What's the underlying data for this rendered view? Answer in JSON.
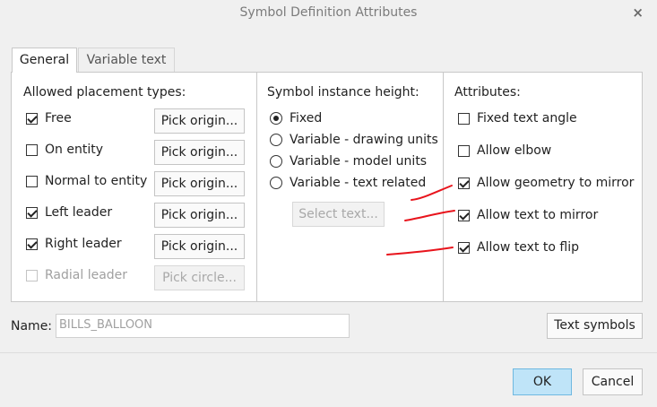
{
  "window": {
    "title": "Symbol Definition Attributes",
    "close_glyph": "×"
  },
  "tabs": [
    {
      "label": "General",
      "active": true
    },
    {
      "label": "Variable text",
      "active": false
    }
  ],
  "placement": {
    "title": "Allowed placement types:",
    "items": [
      {
        "label": "Free",
        "checked": true,
        "enabled": true,
        "button": "Pick origin...",
        "button_enabled": true
      },
      {
        "label": "On entity",
        "checked": false,
        "enabled": true,
        "button": "Pick origin...",
        "button_enabled": true
      },
      {
        "label": "Normal to entity",
        "checked": false,
        "enabled": true,
        "button": "Pick origin...",
        "button_enabled": true
      },
      {
        "label": "Left leader",
        "checked": true,
        "enabled": true,
        "button": "Pick origin...",
        "button_enabled": true
      },
      {
        "label": "Right leader",
        "checked": true,
        "enabled": true,
        "button": "Pick origin...",
        "button_enabled": true
      },
      {
        "label": "Radial leader",
        "checked": false,
        "enabled": false,
        "button": "Pick circle...",
        "button_enabled": false
      }
    ]
  },
  "height": {
    "title": "Symbol instance height:",
    "options": [
      {
        "label": "Fixed",
        "selected": true
      },
      {
        "label": "Variable - drawing units",
        "selected": false
      },
      {
        "label": "Variable - model units",
        "selected": false
      },
      {
        "label": "Variable - text related",
        "selected": false
      }
    ],
    "select_text_button": "Select text..."
  },
  "attributes": {
    "title": "Attributes:",
    "items": [
      {
        "label": "Fixed text angle",
        "checked": false
      },
      {
        "label": "Allow elbow",
        "checked": false
      },
      {
        "label": "Allow geometry to mirror",
        "checked": true
      },
      {
        "label": "Allow text to mirror",
        "checked": true
      },
      {
        "label": "Allow text to flip",
        "checked": true
      }
    ]
  },
  "name": {
    "label": "Name:",
    "value": "BILLS_BALLOON"
  },
  "buttons": {
    "text_symbols": "Text symbols",
    "ok": "OK",
    "cancel": "Cancel"
  },
  "colors": {
    "annotation_marks": "#e8141c",
    "ok_button": "#bfe4f8"
  }
}
